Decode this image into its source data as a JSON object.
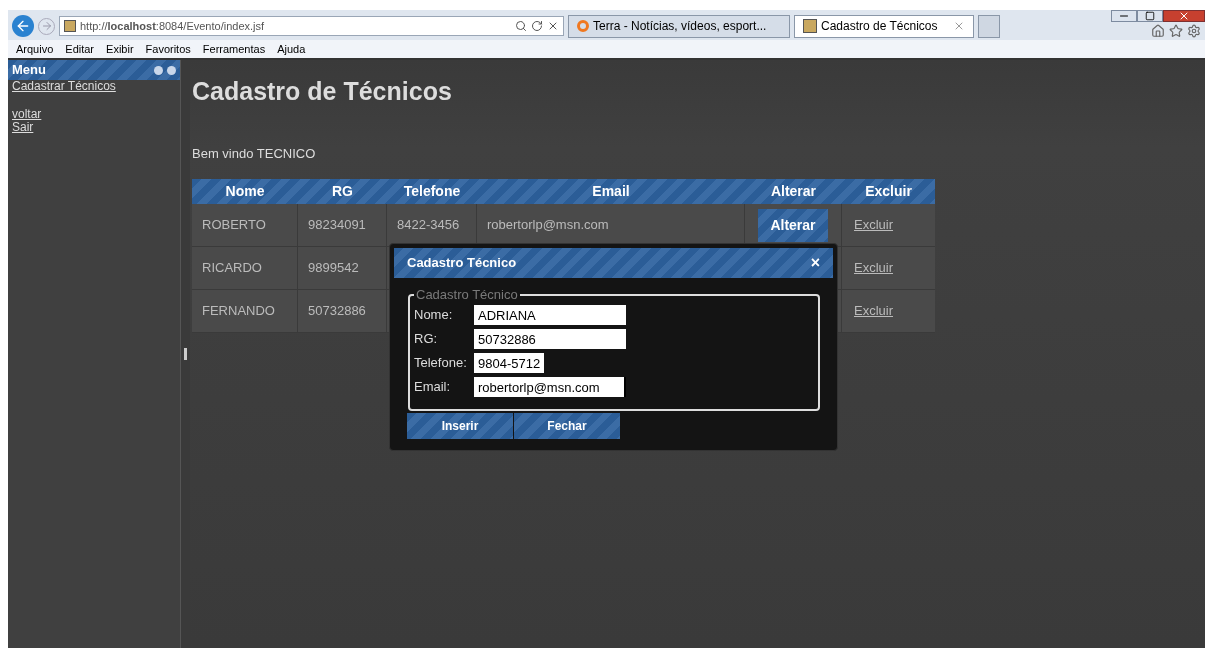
{
  "browser": {
    "address": "http://**localhost**:8084/Evento/index.jsf",
    "tabs": [
      {
        "label": "Terra - Notícias, vídeos, esport...",
        "selected": false,
        "kind": "terra"
      },
      {
        "label": "Cadastro de Técnicos",
        "selected": true,
        "kind": "page"
      }
    ],
    "menu": [
      "Arquivo",
      "Editar",
      "Exibir",
      "Favoritos",
      "Ferramentas",
      "Ajuda"
    ]
  },
  "sidebar": {
    "title": "Menu",
    "links": [
      "Cadastrar Técnicos",
      "voltar",
      "Sair"
    ]
  },
  "page": {
    "title": "Cadastro de Técnicos",
    "welcome": "Bem vindo TECNICO"
  },
  "table": {
    "columns": [
      "Nome",
      "RG",
      "Telefone",
      "Email",
      "Alterar",
      "Excluir"
    ],
    "rows": [
      {
        "name": "ROBERTO",
        "rg": "98234091",
        "phone": "8422-3456",
        "email": "robertorlp@msn.com",
        "edit": "Alterar",
        "delete": "Excluir"
      },
      {
        "name": "RICARDO",
        "rg": "9899542",
        "delete": "Excluir"
      },
      {
        "name": "FERNANDO",
        "rg": "50732886",
        "delete": "Excluir"
      }
    ]
  },
  "dialog": {
    "title": "Cadastro Técnico",
    "close": "×",
    "legend": "Cadastro Técnico",
    "fields": [
      {
        "label": "Nome:",
        "value": "ADRIANA",
        "focused": false
      },
      {
        "label": "RG:",
        "value": "50732886",
        "focused": false
      },
      {
        "label": "Telefone:",
        "value": "9804-5712",
        "focused": false
      },
      {
        "label": "Email:",
        "value": "robertorlp@msn.com",
        "focused": true
      }
    ],
    "buttons": [
      "Inserir",
      "Fechar"
    ]
  }
}
